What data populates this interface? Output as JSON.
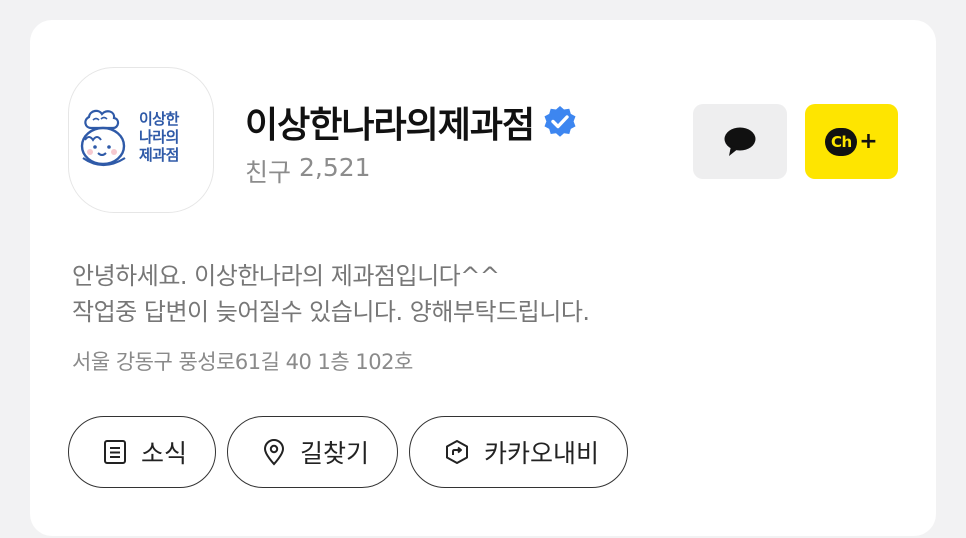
{
  "channel": {
    "logo_lines": [
      "이상한",
      "나라의",
      "제과점"
    ],
    "name": "이상한나라의제과점",
    "verified_icon": "verified-badge-icon",
    "friends_label": "친구",
    "friends_count": "2,521"
  },
  "header_buttons": {
    "chat_icon": "chat-bubble-icon",
    "add_channel_badge": "Ch",
    "add_channel_plus": "+"
  },
  "description": {
    "line1": "안녕하세요. 이상한나라의 제과점입니다^^",
    "line2": "작업중 답변이 늦어질수 있습니다. 양해부탁드립니다."
  },
  "address": "서울 강동구 풍성로61길 40 1층 102호",
  "actions": [
    {
      "label": "소식",
      "icon": "news-document-icon"
    },
    {
      "label": "길찾기",
      "icon": "location-pin-icon"
    },
    {
      "label": "카카오내비",
      "icon": "navigation-icon"
    }
  ],
  "colors": {
    "kakao_yellow": "#fee500",
    "verified_blue": "#3d86f0",
    "logo_blue": "#2f5aa8"
  }
}
